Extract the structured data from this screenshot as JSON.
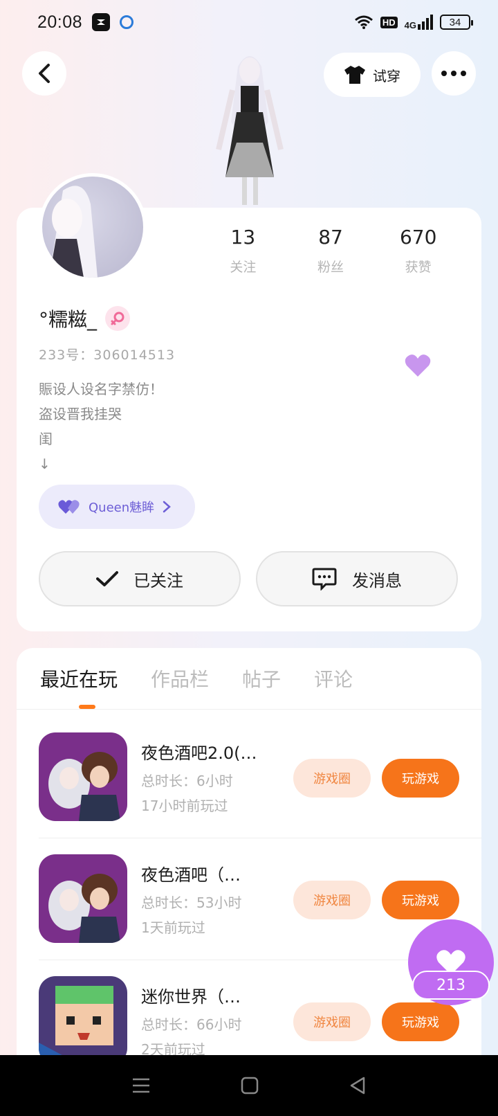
{
  "status_bar": {
    "time": "20:08",
    "hd": "HD",
    "network": "4G",
    "battery": "34"
  },
  "header": {
    "back_icon": "chevron-left-icon",
    "tryon_label": "试穿",
    "tryon_icon": "tshirt-icon",
    "more_icon": "more-dots-icon"
  },
  "profile": {
    "stats": [
      {
        "value": "13",
        "label": "关注"
      },
      {
        "value": "87",
        "label": "粉丝"
      },
      {
        "value": "670",
        "label": "获赞"
      }
    ],
    "username": "°糯糍_",
    "gender": "female",
    "uid": "233号：306014513",
    "bio": [
      "賑设人设名字禁仿！",
      "盗设晋我挂哭",
      "闺",
      "↓"
    ],
    "badge_label": "Queen魅眸",
    "accent": "#c06cf2"
  },
  "actions": {
    "follow_label": "已关注",
    "message_label": "发消息"
  },
  "tabs": [
    {
      "label": "最近在玩",
      "active": true
    },
    {
      "label": "作品栏",
      "active": false
    },
    {
      "label": "帖子",
      "active": false
    },
    {
      "label": "评论",
      "active": false
    }
  ],
  "games": [
    {
      "title": "夜色酒吧2.0(…",
      "duration": "总时长：6小时",
      "last_played": "17小时前玩过",
      "circle_label": "游戏圈",
      "play_label": "玩游戏"
    },
    {
      "title": "夜色酒吧（…",
      "duration": "总时长：53小时",
      "last_played": "1天前玩过",
      "circle_label": "游戏圈",
      "play_label": "玩游戏"
    },
    {
      "title": "迷你世界（…",
      "duration": "总时长：66小时",
      "last_played": "2天前玩过",
      "circle_label": "游戏圈",
      "play_label": "玩游戏"
    }
  ],
  "fab": {
    "icon": "heart-icon",
    "count": "213"
  }
}
